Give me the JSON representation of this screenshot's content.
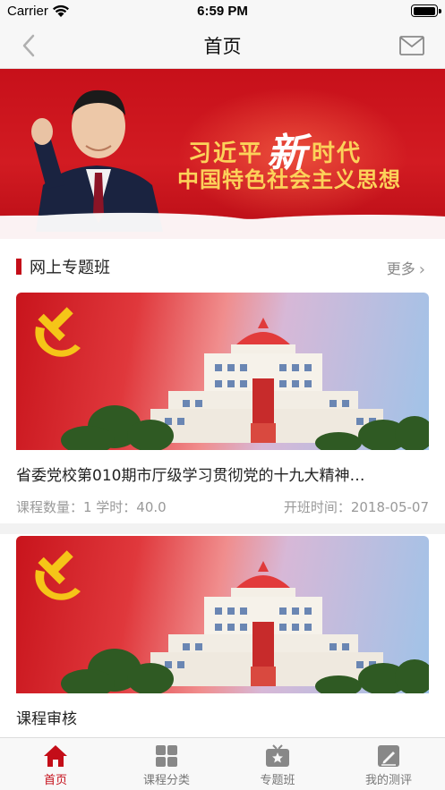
{
  "status_bar": {
    "carrier": "Carrier",
    "time": "6:59 PM"
  },
  "nav": {
    "title": "首页",
    "back_icon": "chevron-left-icon",
    "mail_icon": "mail-icon"
  },
  "banner": {
    "line1_part1": "习近平",
    "line1_big": "新",
    "line1_part2": "时代",
    "line2": "中国特色社会主义思想"
  },
  "section": {
    "title": "网上专题班",
    "more_label": "更多"
  },
  "courses": [
    {
      "title": "省委党校第010期市厅级学习贯彻党的十九大精神…",
      "meta_left": "课程数量：1 学时：40.0",
      "meta_right": "开班时间：2018-05-07"
    },
    {
      "title": "课程审核"
    }
  ],
  "tabs": [
    {
      "label": "首页",
      "icon": "home-icon",
      "active": true
    },
    {
      "label": "课程分类",
      "icon": "grid-icon",
      "active": false
    },
    {
      "label": "专题班",
      "icon": "tv-star-icon",
      "active": false
    },
    {
      "label": "我的测评",
      "icon": "edit-note-icon",
      "active": false
    }
  ],
  "colors": {
    "accent": "#c40d18",
    "nav_bg": "#f7f7f7",
    "banner_red": "#d21b22",
    "gold": "#fcd25a"
  }
}
